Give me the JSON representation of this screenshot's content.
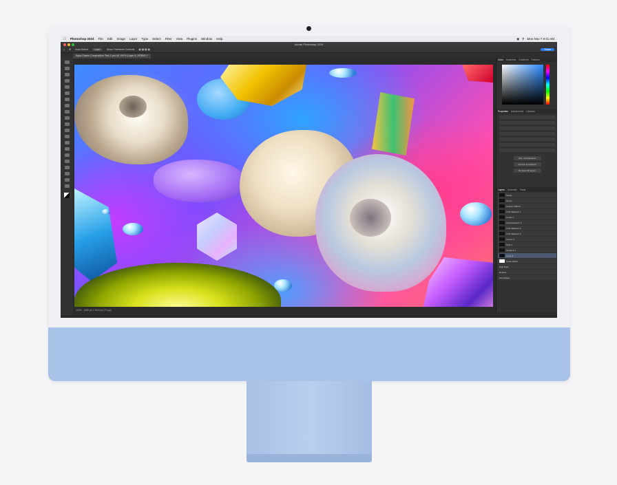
{
  "menubar": {
    "app_name": "Photoshop 2024",
    "items": [
      "File",
      "Edit",
      "Image",
      "Layer",
      "Type",
      "Select",
      "Filter",
      "View",
      "Plugins",
      "Window",
      "Help"
    ],
    "clock": "Mon Nov 7 9:41 AM"
  },
  "window": {
    "title": "Adobe Photoshop 2024",
    "doc_tab": "Aqua Drams Composition Test-1.psd @ 100% (Layer 8, RGB/8*) *"
  },
  "options_bar": {
    "select_label": "Auto-Select",
    "select_value": "Layer",
    "transform_label": "Show Transform Controls",
    "share_label": "Share"
  },
  "statusbar": {
    "zoom": "100%",
    "size": "4480 px x 2520 px (72 ppi)"
  },
  "panels": {
    "color_tabs": [
      "Color",
      "Swatches",
      "Gradients",
      "Patterns"
    ],
    "props_tabs": [
      "Properties",
      "Adjustments",
      "Libraries"
    ],
    "props_buttons": [
      "Vert. Combinations",
      "Convert to Artboard",
      "Remove All Layers"
    ],
    "layers_tabs": [
      "Layers",
      "Channels",
      "Paths"
    ],
    "layer_names": [
      "Shells",
      "Group",
      "Ambient Effects",
      "Color Balance 1",
      "Levels 1",
      "Hue/Saturation 2",
      "Color Balance 2",
      "Color Balance 3",
      "Curves 1",
      "Shell 1",
      "Gradient 1",
      "Layer 8",
      "Smart Filters",
      "High Pass",
      "Reduce",
      "Find Edges"
    ]
  },
  "colors": {
    "accent": "#2d7ff9",
    "imac_blue": "#a9c3e8"
  }
}
